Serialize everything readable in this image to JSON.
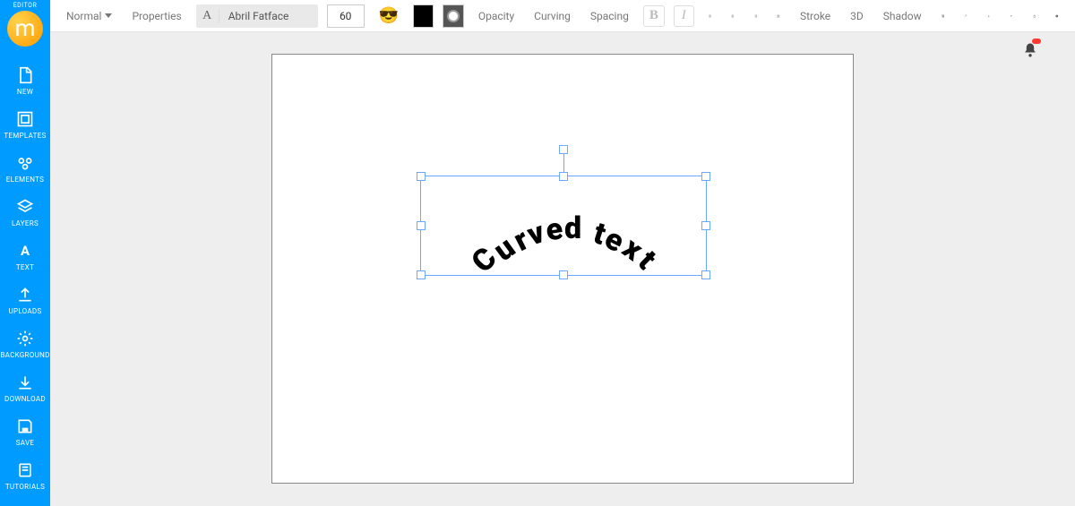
{
  "sidebar": {
    "editor_tag": "EDITOR",
    "logo_letter": "m",
    "items": [
      {
        "label": "NEW"
      },
      {
        "label": "TEMPLATES"
      },
      {
        "label": "ELEMENTS"
      },
      {
        "label": "LAYERS"
      },
      {
        "label": "TEXT"
      },
      {
        "label": "UPLOADS"
      },
      {
        "label": "BACKGROUND"
      },
      {
        "label": "DOWNLOAD"
      },
      {
        "label": "SAVE"
      },
      {
        "label": "TUTORIALS"
      }
    ]
  },
  "toolbar": {
    "mode": "Normal",
    "properties": "Properties",
    "font_letter": "A",
    "font_name": "Abril Fatface",
    "font_size": "60",
    "emoji": "😎",
    "opacity": "Opacity",
    "curving": "Curving",
    "spacing": "Spacing",
    "bold": "B",
    "italic": "I",
    "stroke": "Stroke",
    "three_d": "3D",
    "shadow": "Shadow"
  },
  "canvas": {
    "text": "Curved text",
    "letters": [
      "C",
      "u",
      "r",
      "v",
      "e",
      "d",
      " ",
      "t",
      "e",
      "x",
      "t"
    ],
    "fill_color": "#000000",
    "bg_color": "#ffffff"
  }
}
